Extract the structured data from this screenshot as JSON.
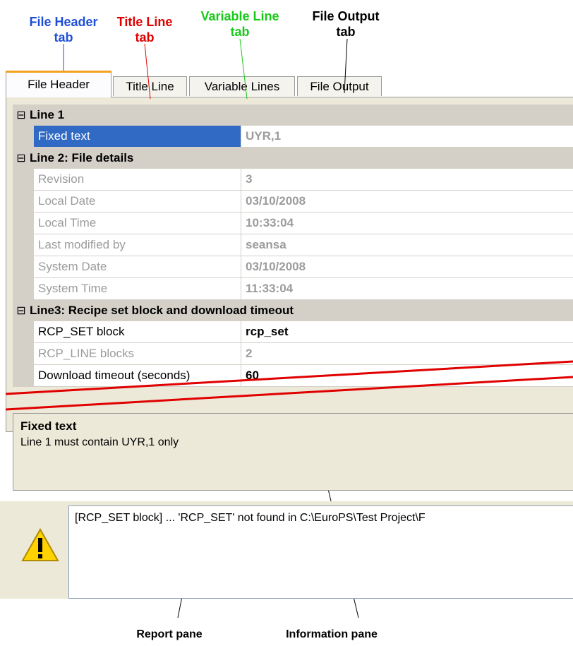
{
  "annotations": {
    "file_header": [
      "File Header",
      "tab"
    ],
    "title_line": [
      "Title Line",
      "tab"
    ],
    "variable_line": [
      "Variable Line",
      "tab"
    ],
    "file_output": [
      "File Output",
      "tab"
    ],
    "report_pane": "Report pane",
    "information_pane": "Information pane"
  },
  "tabs": [
    "File Header",
    "Title Line",
    "Variable Lines",
    "File Output"
  ],
  "categories": {
    "line1": "Line 1",
    "line2": "Line 2:  File details",
    "line3": "Line3:  Recipe set block and download timeout"
  },
  "props": {
    "fixed_text": {
      "name": "Fixed text",
      "value": "UYR,1"
    },
    "revision": {
      "name": "Revision",
      "value": "3"
    },
    "local_date": {
      "name": "Local Date",
      "value": "03/10/2008"
    },
    "local_time": {
      "name": "Local Time",
      "value": "10:33:04"
    },
    "last_modified": {
      "name": "Last modified by",
      "value": "seansa"
    },
    "system_date": {
      "name": "System Date",
      "value": "03/10/2008"
    },
    "system_time": {
      "name": "System Time",
      "value": "11:33:04"
    },
    "rcp_set": {
      "name": "RCP_SET block",
      "value": "rcp_set"
    },
    "rcp_line": {
      "name": "RCP_LINE blocks",
      "value": "2"
    },
    "timeout": {
      "name": "Download timeout (seconds)",
      "value": "60"
    }
  },
  "info": {
    "title": "Fixed text",
    "description": "Line 1 must contain UYR,1 only"
  },
  "report": {
    "message": "[RCP_SET block]   ...   'RCP_SET' not found in C:\\EuroPS\\Test Project\\F"
  },
  "colors": {
    "accent": "#f4a21e",
    "selection": "#316ac5",
    "file_header_annotation": "#1f4fd6",
    "title_annotation": "#e00000",
    "variable_annotation": "#19c919"
  }
}
